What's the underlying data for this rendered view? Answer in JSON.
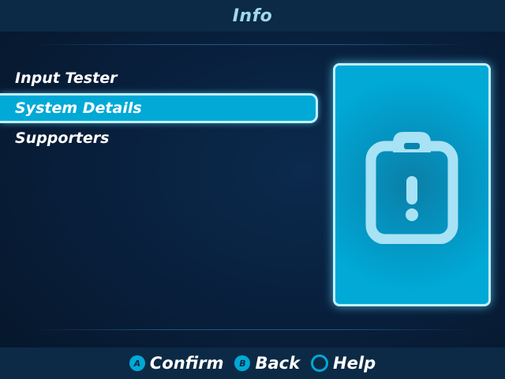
{
  "header": {
    "title": "Info"
  },
  "menu": {
    "items": [
      {
        "label": "Input Tester"
      },
      {
        "label": "System Details",
        "selected": true
      },
      {
        "label": "Supporters"
      }
    ]
  },
  "preview": {
    "icon": "clipboard-alert-icon"
  },
  "footer": {
    "hints": [
      {
        "button": "A",
        "label": "Confirm"
      },
      {
        "button": "B",
        "label": "Back"
      },
      {
        "button": "",
        "label": "Help"
      }
    ]
  },
  "colors": {
    "accent": "#00a9d6",
    "accent_border": "#bff0ff",
    "bar": "#0c2a45",
    "background": "#081e3a",
    "icon": "#a8e2f5"
  }
}
